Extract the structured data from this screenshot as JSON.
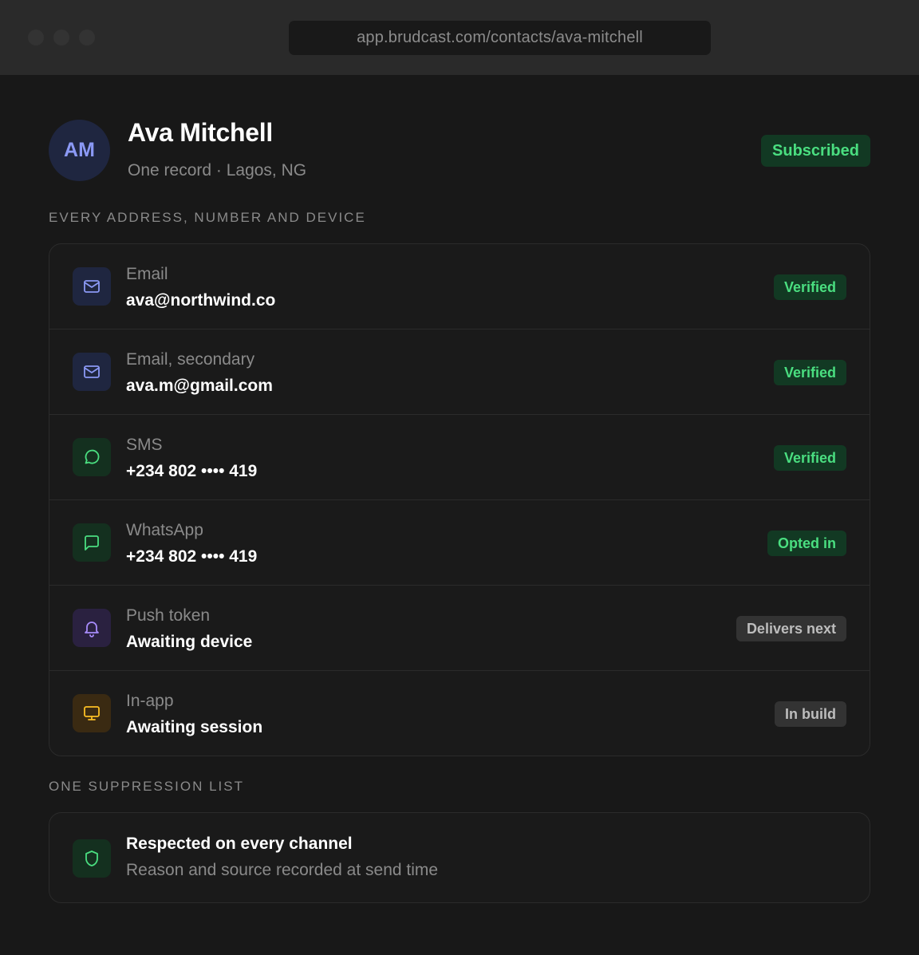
{
  "browser": {
    "url": "app.brudcast.com/contacts/ava-mitchell"
  },
  "contact": {
    "initials": "AM",
    "name": "Ava Mitchell",
    "subtitle": "One record · Lagos, NG",
    "status": "Subscribed"
  },
  "channels_section": {
    "heading": "EVERY ADDRESS, NUMBER AND DEVICE",
    "items": [
      {
        "label": "Email",
        "value": "ava@northwind.co",
        "status": "Verified",
        "icon": "mail-icon",
        "status_color": "#4ade80"
      },
      {
        "label": "Email, secondary",
        "value": "ava.m@gmail.com",
        "status": "Verified",
        "icon": "mail-icon",
        "status_color": "#4ade80"
      },
      {
        "label": "SMS",
        "value": "+234 802 •••• 419",
        "status": "Verified",
        "icon": "chat-bubble-icon",
        "status_color": "#4ade80"
      },
      {
        "label": "WhatsApp",
        "value": "+234 802 •••• 419",
        "status": "Opted in",
        "icon": "message-square-icon",
        "status_color": "#4ade80"
      },
      {
        "label": "Push token",
        "value": "Awaiting device",
        "status": "Delivers next",
        "icon": "bell-icon",
        "status_color": "#bdbdbd"
      },
      {
        "label": "In-app",
        "value": "Awaiting session",
        "status": "In build",
        "icon": "monitor-icon",
        "status_color": "#bdbdbd"
      }
    ]
  },
  "suppression_section": {
    "heading": "ONE SUPPRESSION LIST",
    "title": "Respected on every channel",
    "subtitle": "Reason and source recorded at send time",
    "icon": "shield-icon"
  },
  "colors": {
    "background": "#181818",
    "accent_green": "#4ade80",
    "accent_indigo": "#8b99f5",
    "accent_purple": "#a78bfa",
    "accent_amber": "#fbbf24"
  }
}
